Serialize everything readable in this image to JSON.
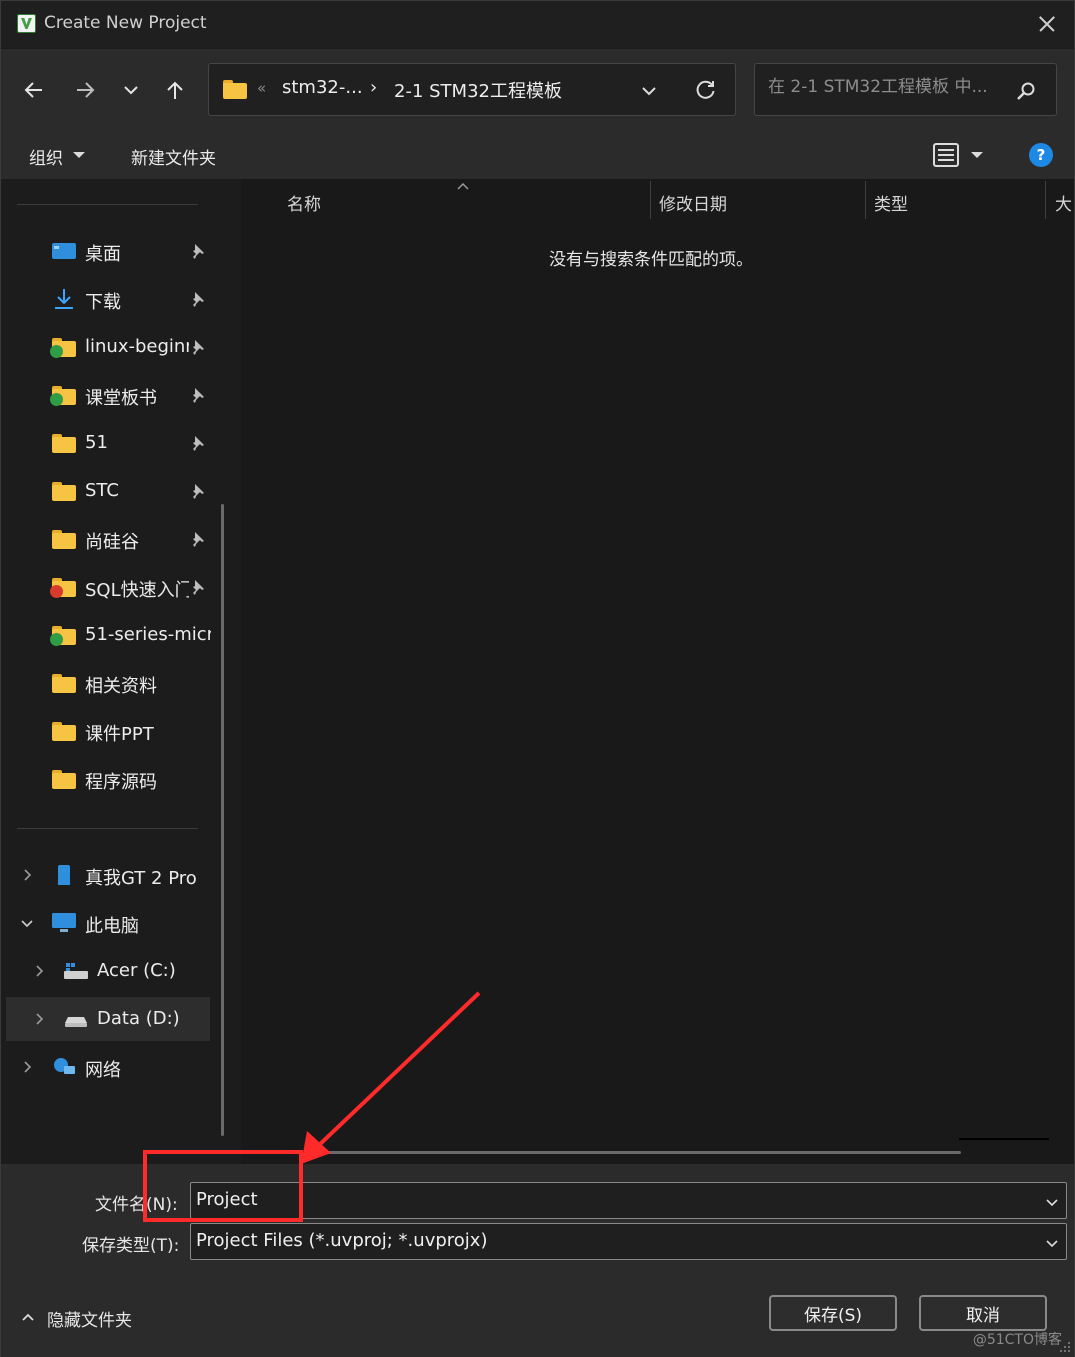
{
  "window": {
    "title": "Create New Project",
    "close_icon": "close-icon",
    "accent_color": "#1e88e5",
    "annotation_color": "#ff2b2b"
  },
  "nav": {
    "address": {
      "chevrons": "«",
      "segment1": "stm32-...",
      "separator": "›",
      "segment2": "2-1 STM32工程模板"
    },
    "search_placeholder": "在 2-1 STM32工程模板 中..."
  },
  "toolbar": {
    "organize": "组织",
    "new_folder": "新建文件夹",
    "help": "?"
  },
  "sidebar": {
    "quick_access": [
      {
        "label": "桌面",
        "icon": "desktop-icon",
        "pinned": true
      },
      {
        "label": "下载",
        "icon": "download-icon",
        "pinned": true
      },
      {
        "label": "linux-beginr",
        "icon": "folder-sync-icon",
        "pinned": true
      },
      {
        "label": "课堂板书",
        "icon": "folder-sync-icon",
        "pinned": true
      },
      {
        "label": "51",
        "icon": "folder-icon",
        "pinned": true
      },
      {
        "label": "STC",
        "icon": "folder-icon",
        "pinned": true
      },
      {
        "label": "尚硅谷",
        "icon": "folder-icon",
        "pinned": true
      },
      {
        "label": "SQL快速入门",
        "icon": "folder-error-icon",
        "pinned": true
      },
      {
        "label": "51-series-micr",
        "icon": "folder-sync-icon",
        "pinned": false
      },
      {
        "label": "相关资料",
        "icon": "folder-icon",
        "pinned": false
      },
      {
        "label": "课件PPT",
        "icon": "folder-icon",
        "pinned": false
      },
      {
        "label": "程序源码",
        "icon": "folder-icon",
        "pinned": false
      }
    ],
    "tree": [
      {
        "label": "真我GT 2 Pro",
        "icon": "phone-icon"
      },
      {
        "label": "此电脑",
        "icon": "computer-icon"
      },
      {
        "label": "Acer (C:)",
        "icon": "drive-c-icon"
      },
      {
        "label": "Data (D:)",
        "icon": "drive-icon"
      },
      {
        "label": "网络",
        "icon": "network-icon"
      }
    ]
  },
  "content": {
    "columns": [
      "名称",
      "修改日期",
      "类型",
      "大"
    ],
    "empty_message": "没有与搜索条件匹配的项。"
  },
  "bottom": {
    "filename_label": "文件名(N):",
    "filename_value": "Project",
    "filetype_label": "保存类型(T):",
    "filetype_value": "Project Files (*.uvproj; *.uvprojx)",
    "hide_folders": "隐藏文件夹",
    "save_button": "保存(S)",
    "cancel_button": "取消"
  },
  "watermark": "@51CTO博客"
}
